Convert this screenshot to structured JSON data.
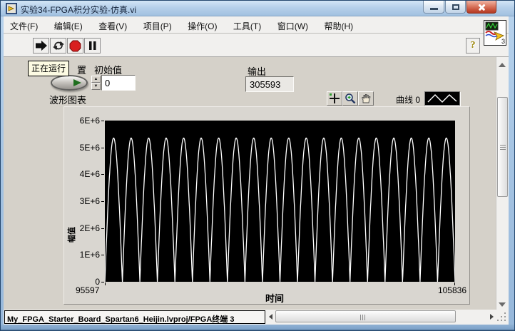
{
  "window": {
    "title": "实验34-FPGA积分实验-仿真.vi"
  },
  "menu": {
    "items": [
      {
        "label": "文件(F)"
      },
      {
        "label": "编辑(E)"
      },
      {
        "label": "查看(V)"
      },
      {
        "label": "项目(P)"
      },
      {
        "label": "操作(O)"
      },
      {
        "label": "工具(T)"
      },
      {
        "label": "窗口(W)"
      },
      {
        "label": "帮助(H)"
      }
    ]
  },
  "toolbar": {
    "help_label": "?"
  },
  "vi_icon": {
    "badge": "3"
  },
  "panel": {
    "running_tooltip": "正在运行",
    "partial_label": "置",
    "chart_label": "波形图表",
    "initial": {
      "label": "初始值",
      "value": "0"
    },
    "output": {
      "label": "输出",
      "value": "305593"
    }
  },
  "chart_data": {
    "type": "line",
    "title": "波形图表",
    "xlabel": "时间",
    "ylabel": "幅值",
    "xlim": [
      95597,
      105836
    ],
    "ylim": [
      0,
      6000000
    ],
    "ytick_labels": [
      "6E+6",
      "5E+6",
      "4E+6",
      "3E+6",
      "2E+6",
      "1E+6",
      "0"
    ],
    "xtick_labels": [
      "95597",
      "105836"
    ],
    "grid": false,
    "plot_bg": "#000000",
    "line_color": "#ffffff",
    "legend_position": "top-right",
    "series": [
      {
        "name": "曲线 0",
        "color": "#ffffff",
        "shape": "abs_sine",
        "amplitude": 5350000,
        "min": 0,
        "cycles": 20
      }
    ]
  },
  "status_bar": {
    "target": "My_FPGA_Starter_Board_Spartan6_Heijin.lvproj/FPGA终端 3"
  }
}
